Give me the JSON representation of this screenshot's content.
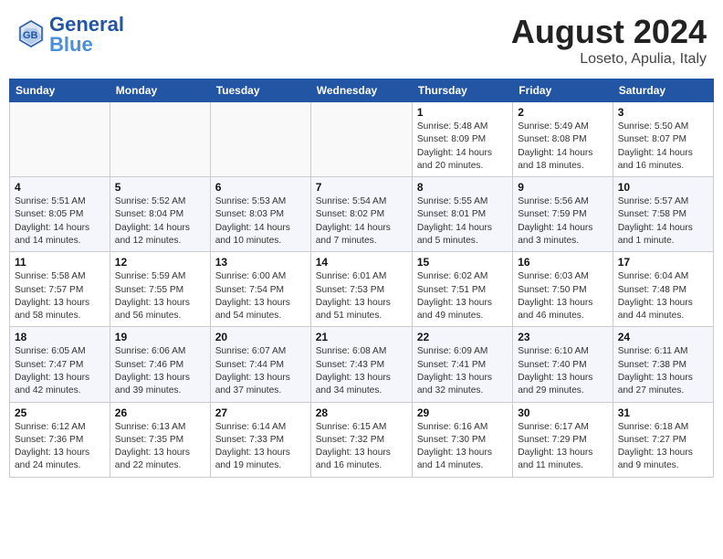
{
  "header": {
    "month_year": "August 2024",
    "location": "Loseto, Apulia, Italy",
    "logo_line1": "General",
    "logo_line2": "Blue"
  },
  "weekdays": [
    "Sunday",
    "Monday",
    "Tuesday",
    "Wednesday",
    "Thursday",
    "Friday",
    "Saturday"
  ],
  "weeks": [
    [
      {
        "day": "",
        "info": ""
      },
      {
        "day": "",
        "info": ""
      },
      {
        "day": "",
        "info": ""
      },
      {
        "day": "",
        "info": ""
      },
      {
        "day": "1",
        "info": "Sunrise: 5:48 AM\nSunset: 8:09 PM\nDaylight: 14 hours\nand 20 minutes."
      },
      {
        "day": "2",
        "info": "Sunrise: 5:49 AM\nSunset: 8:08 PM\nDaylight: 14 hours\nand 18 minutes."
      },
      {
        "day": "3",
        "info": "Sunrise: 5:50 AM\nSunset: 8:07 PM\nDaylight: 14 hours\nand 16 minutes."
      }
    ],
    [
      {
        "day": "4",
        "info": "Sunrise: 5:51 AM\nSunset: 8:05 PM\nDaylight: 14 hours\nand 14 minutes."
      },
      {
        "day": "5",
        "info": "Sunrise: 5:52 AM\nSunset: 8:04 PM\nDaylight: 14 hours\nand 12 minutes."
      },
      {
        "day": "6",
        "info": "Sunrise: 5:53 AM\nSunset: 8:03 PM\nDaylight: 14 hours\nand 10 minutes."
      },
      {
        "day": "7",
        "info": "Sunrise: 5:54 AM\nSunset: 8:02 PM\nDaylight: 14 hours\nand 7 minutes."
      },
      {
        "day": "8",
        "info": "Sunrise: 5:55 AM\nSunset: 8:01 PM\nDaylight: 14 hours\nand 5 minutes."
      },
      {
        "day": "9",
        "info": "Sunrise: 5:56 AM\nSunset: 7:59 PM\nDaylight: 14 hours\nand 3 minutes."
      },
      {
        "day": "10",
        "info": "Sunrise: 5:57 AM\nSunset: 7:58 PM\nDaylight: 14 hours\nand 1 minute."
      }
    ],
    [
      {
        "day": "11",
        "info": "Sunrise: 5:58 AM\nSunset: 7:57 PM\nDaylight: 13 hours\nand 58 minutes."
      },
      {
        "day": "12",
        "info": "Sunrise: 5:59 AM\nSunset: 7:55 PM\nDaylight: 13 hours\nand 56 minutes."
      },
      {
        "day": "13",
        "info": "Sunrise: 6:00 AM\nSunset: 7:54 PM\nDaylight: 13 hours\nand 54 minutes."
      },
      {
        "day": "14",
        "info": "Sunrise: 6:01 AM\nSunset: 7:53 PM\nDaylight: 13 hours\nand 51 minutes."
      },
      {
        "day": "15",
        "info": "Sunrise: 6:02 AM\nSunset: 7:51 PM\nDaylight: 13 hours\nand 49 minutes."
      },
      {
        "day": "16",
        "info": "Sunrise: 6:03 AM\nSunset: 7:50 PM\nDaylight: 13 hours\nand 46 minutes."
      },
      {
        "day": "17",
        "info": "Sunrise: 6:04 AM\nSunset: 7:48 PM\nDaylight: 13 hours\nand 44 minutes."
      }
    ],
    [
      {
        "day": "18",
        "info": "Sunrise: 6:05 AM\nSunset: 7:47 PM\nDaylight: 13 hours\nand 42 minutes."
      },
      {
        "day": "19",
        "info": "Sunrise: 6:06 AM\nSunset: 7:46 PM\nDaylight: 13 hours\nand 39 minutes."
      },
      {
        "day": "20",
        "info": "Sunrise: 6:07 AM\nSunset: 7:44 PM\nDaylight: 13 hours\nand 37 minutes."
      },
      {
        "day": "21",
        "info": "Sunrise: 6:08 AM\nSunset: 7:43 PM\nDaylight: 13 hours\nand 34 minutes."
      },
      {
        "day": "22",
        "info": "Sunrise: 6:09 AM\nSunset: 7:41 PM\nDaylight: 13 hours\nand 32 minutes."
      },
      {
        "day": "23",
        "info": "Sunrise: 6:10 AM\nSunset: 7:40 PM\nDaylight: 13 hours\nand 29 minutes."
      },
      {
        "day": "24",
        "info": "Sunrise: 6:11 AM\nSunset: 7:38 PM\nDaylight: 13 hours\nand 27 minutes."
      }
    ],
    [
      {
        "day": "25",
        "info": "Sunrise: 6:12 AM\nSunset: 7:36 PM\nDaylight: 13 hours\nand 24 minutes."
      },
      {
        "day": "26",
        "info": "Sunrise: 6:13 AM\nSunset: 7:35 PM\nDaylight: 13 hours\nand 22 minutes."
      },
      {
        "day": "27",
        "info": "Sunrise: 6:14 AM\nSunset: 7:33 PM\nDaylight: 13 hours\nand 19 minutes."
      },
      {
        "day": "28",
        "info": "Sunrise: 6:15 AM\nSunset: 7:32 PM\nDaylight: 13 hours\nand 16 minutes."
      },
      {
        "day": "29",
        "info": "Sunrise: 6:16 AM\nSunset: 7:30 PM\nDaylight: 13 hours\nand 14 minutes."
      },
      {
        "day": "30",
        "info": "Sunrise: 6:17 AM\nSunset: 7:29 PM\nDaylight: 13 hours\nand 11 minutes."
      },
      {
        "day": "31",
        "info": "Sunrise: 6:18 AM\nSunset: 7:27 PM\nDaylight: 13 hours\nand 9 minutes."
      }
    ]
  ]
}
